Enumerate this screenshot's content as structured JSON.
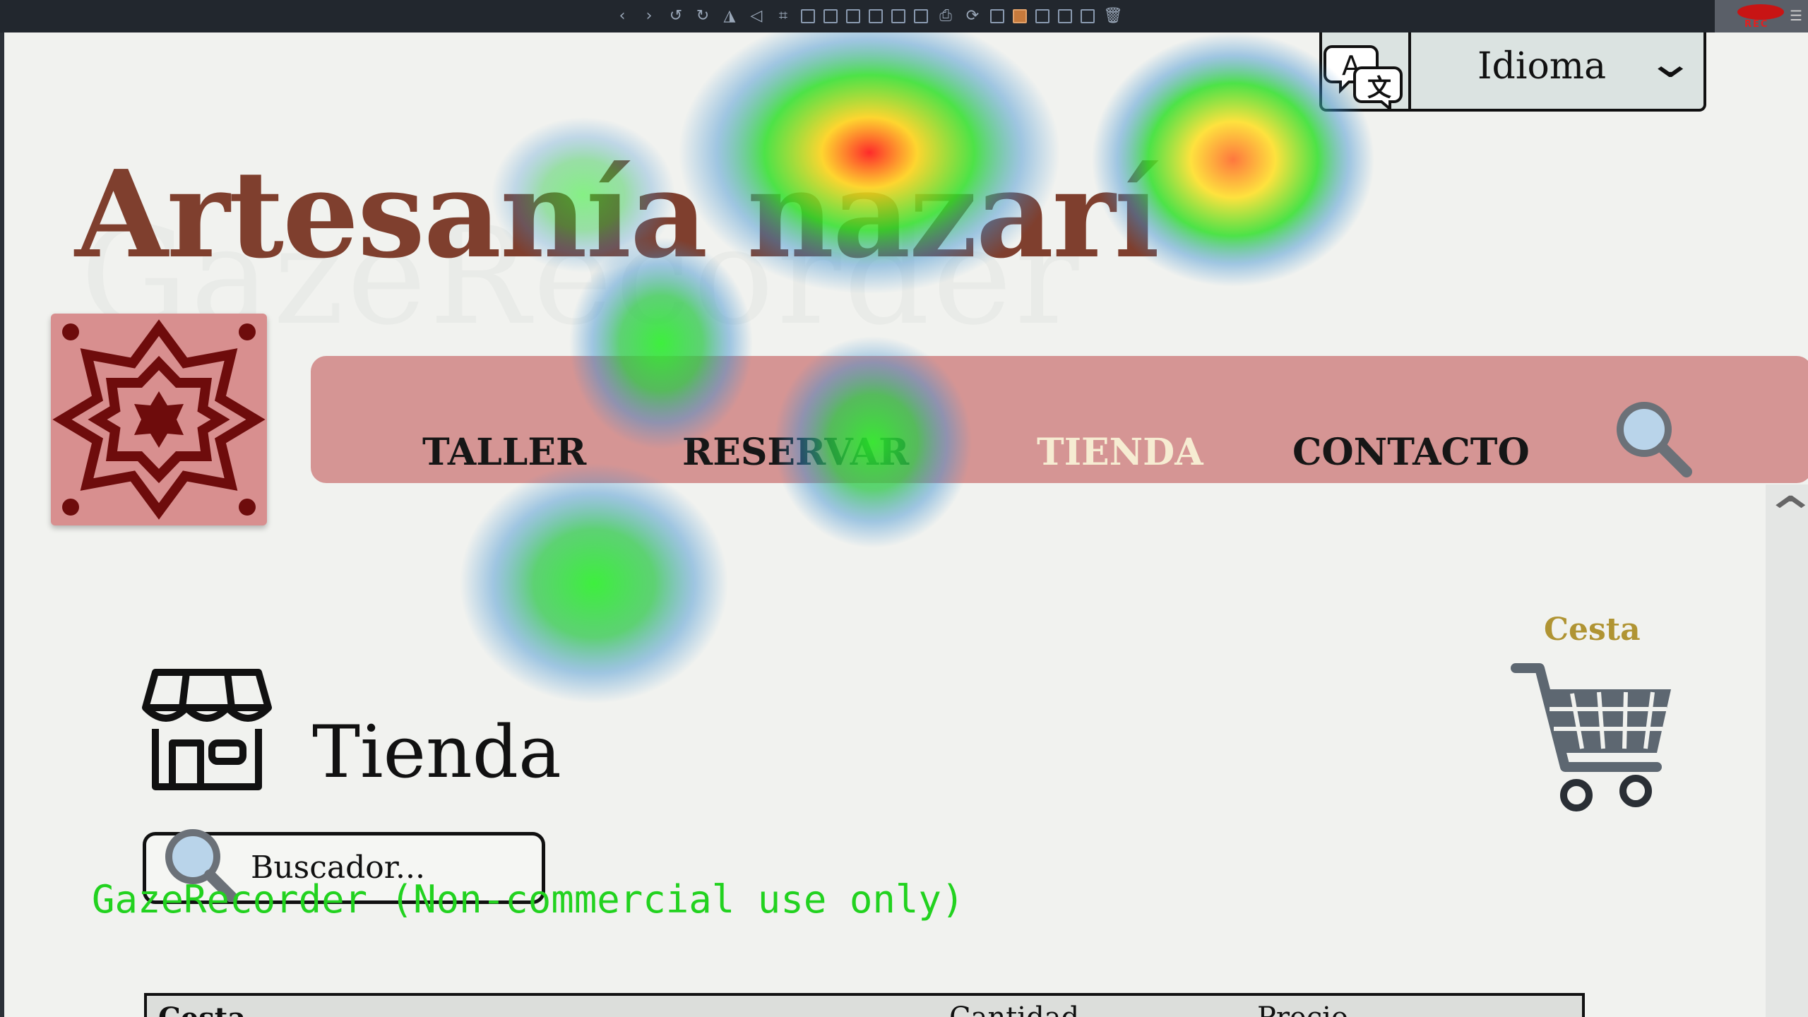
{
  "recorder": {
    "toolbar_icons": [
      "chevron-left-icon",
      "chevron-right-icon",
      "rotate-ccw-icon",
      "rotate-cw-icon",
      "flip-icon",
      "triangle-icon",
      "crop-icon",
      "frame-1-icon",
      "frame-2-icon",
      "frame-3-icon",
      "frame-4-icon",
      "frame-5-icon",
      "frame-6-icon",
      "print-icon",
      "refresh-icon",
      "layout-1-icon",
      "layout-2-icon",
      "screen-icon",
      "image-icon",
      "grid-icon",
      "trash-icon"
    ],
    "rec_label": "REC",
    "watermark_overlay": "GazeRecorder (Non-commercial use only)",
    "watermark_big": "GazeRecorder"
  },
  "header": {
    "site_title": "Artesanía nazarí",
    "language_label": "Idioma"
  },
  "nav": {
    "items": [
      {
        "label": "TALLER",
        "active": false
      },
      {
        "label": "RESERVAR",
        "active": false
      },
      {
        "label": "TIENDA",
        "active": true
      },
      {
        "label": "CONTACTO",
        "active": false
      }
    ]
  },
  "cart": {
    "label": "Cesta"
  },
  "main": {
    "section_title": "Tienda",
    "search_placeholder": "Buscador..."
  },
  "table": {
    "headers": [
      "Cesta",
      "Cantidad",
      "Precio"
    ]
  },
  "colors": {
    "title": "#7f3f2e",
    "nav_bg": "#d59594",
    "nav_active": "#f6ecd2",
    "cart_label": "#b09433",
    "logo_pattern": "#6e0c0c"
  }
}
